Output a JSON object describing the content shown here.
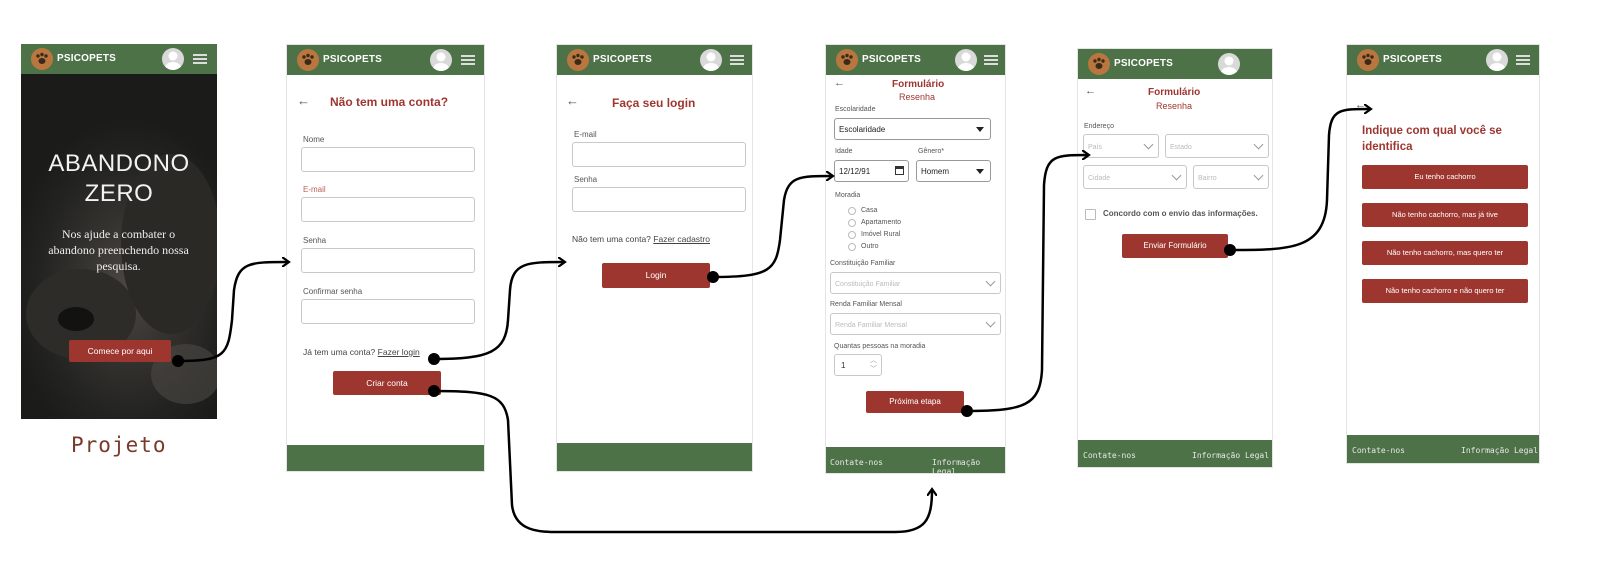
{
  "brand": "PSICOPETS",
  "colors": {
    "green": "#4e7248",
    "red": "#9e3630",
    "paw": "#b9773f"
  },
  "icons": [
    "paw-icon",
    "avatar-icon",
    "hamburger-menu-icon",
    "back-arrow-icon",
    "calendar-icon",
    "chevron-down-icon",
    "spinner-arrows-icon"
  ],
  "screen1": {
    "hero_title_line1": "ABANDONO",
    "hero_title_line2": "ZERO",
    "hero_text": "Nos ajude a combater o abandono preenchendo nossa pesquisa.",
    "cta": "Comece por aqui",
    "caption": "Projeto"
  },
  "screen2": {
    "title": "Não tem uma conta?",
    "name_label": "Nome",
    "email_label": "E-mail",
    "password_label": "Senha",
    "confirm_label": "Confirmar senha",
    "has_account": "Já tem uma conta?",
    "login_link": "Fazer login",
    "create_button": "Criar conta"
  },
  "screen3": {
    "title": "Faça seu login",
    "email_label": "E-mail",
    "password_label": "Senha",
    "no_account": "Não tem uma conta?",
    "signup_link": "Fazer cadastro",
    "login_button": "Login"
  },
  "screen4": {
    "title": "Formulário",
    "subtitle": "Resenha",
    "education_label": "Escolaridade",
    "education_value": "Escolaridade",
    "age_label": "Idade",
    "age_value": "12/12/91",
    "gender_label": "Gênero*",
    "gender_value": "Homem",
    "housing_label": "Moradia",
    "housing_options": [
      "Casa",
      "Apartamento",
      "Imóvel Rural",
      "Outro"
    ],
    "family_label": "Constituição Familiar",
    "family_placeholder": "Constituição Familiar",
    "income_label": "Renda Familiar Mensal",
    "income_placeholder": "Renda Familiar Mensal",
    "people_label": "Quantas pessoas na moradia",
    "people_value": "1",
    "next_button": "Próxima etapa",
    "contact": "Contate-nos",
    "legal": "Informação Legal"
  },
  "screen5": {
    "title": "Formulário",
    "subtitle": "Resenha",
    "address_label": "Endereço",
    "country": "País",
    "state": "Estado",
    "city": "Cidade",
    "district": "Bairro",
    "agree": "Concordo com o envio das informações.",
    "submit_button": "Enviar Formulário",
    "contact": "Contate-nos",
    "legal": "Informação Legal"
  },
  "screen6": {
    "title": "Indique com qual você se identifica",
    "options": [
      "Eu tenho cachorro",
      "Não tenho cachorro, mas já tive",
      "Não tenho cachorro, mas quero ter",
      "Não tenho cachorro e não quero ter"
    ],
    "contact": "Contate-nos",
    "legal": "Informação Legal"
  }
}
